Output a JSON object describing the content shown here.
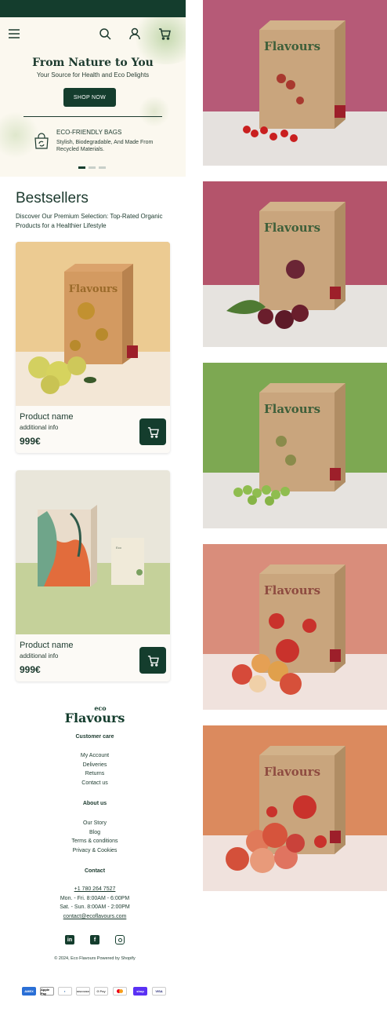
{
  "header": {
    "menu_icon": "hamburger-menu-icon",
    "search_icon": "search-icon",
    "account_icon": "user-icon",
    "cart_icon": "cart-icon"
  },
  "hero": {
    "title": "From Nature to You",
    "subtitle": "Your Source for Health and Eco Delights",
    "button_label": "SHOP NOW",
    "feature_title": "ECO-FRIENDLY BAGS",
    "feature_desc": "Stylish, Biodegradable, And Made From Recycled Materials.",
    "slides": 3,
    "active_slide": 1
  },
  "bestsellers": {
    "title": "Bestsellers",
    "subtitle": "Discover Our Premium Selection: Top-Rated Organic Products for a Healthier Lifestyle",
    "products": [
      {
        "name": "Product name",
        "info": "additional info",
        "price": "999€"
      },
      {
        "name": "Product name",
        "info": "additional info",
        "price": "999€"
      }
    ]
  },
  "brand": {
    "logo_small": "eco",
    "logo_main": "Flavours"
  },
  "footer": {
    "customer_care": {
      "heading": "Customer care",
      "links": [
        "My Account",
        "Deliveries",
        "Returns",
        "Contact us"
      ]
    },
    "about": {
      "heading": "About us",
      "links": [
        "Our Story",
        "Blog",
        "Terms & conditions",
        "Privacy & Cookies"
      ]
    },
    "contact": {
      "heading": "Contact",
      "phone": "+1 780 264 7527",
      "hours_week": "Mon. - Fri. 8:00AM - 6:00PM",
      "hours_weekend": "Sat. - Sun. 8:00AM - 2:00PM",
      "email": "contact@ecoflavours.com"
    },
    "social": [
      "linkedin-icon",
      "facebook-icon",
      "instagram-icon"
    ],
    "copyright": "© 2024, Eco Flavours Powered by Shopify",
    "payments": [
      "AMEX",
      "Apple Pay",
      "Diners",
      "DISCOVER",
      "G Pay",
      "Mastercard",
      "shop",
      "VISA"
    ]
  },
  "colors": {
    "brand_green": "#143d2d",
    "hero_bg": "#fbf8ef",
    "photo_bgs": [
      "#b65a77",
      "#b4546b",
      "#7da852",
      "#d98d7b",
      "#db8a5e"
    ]
  }
}
